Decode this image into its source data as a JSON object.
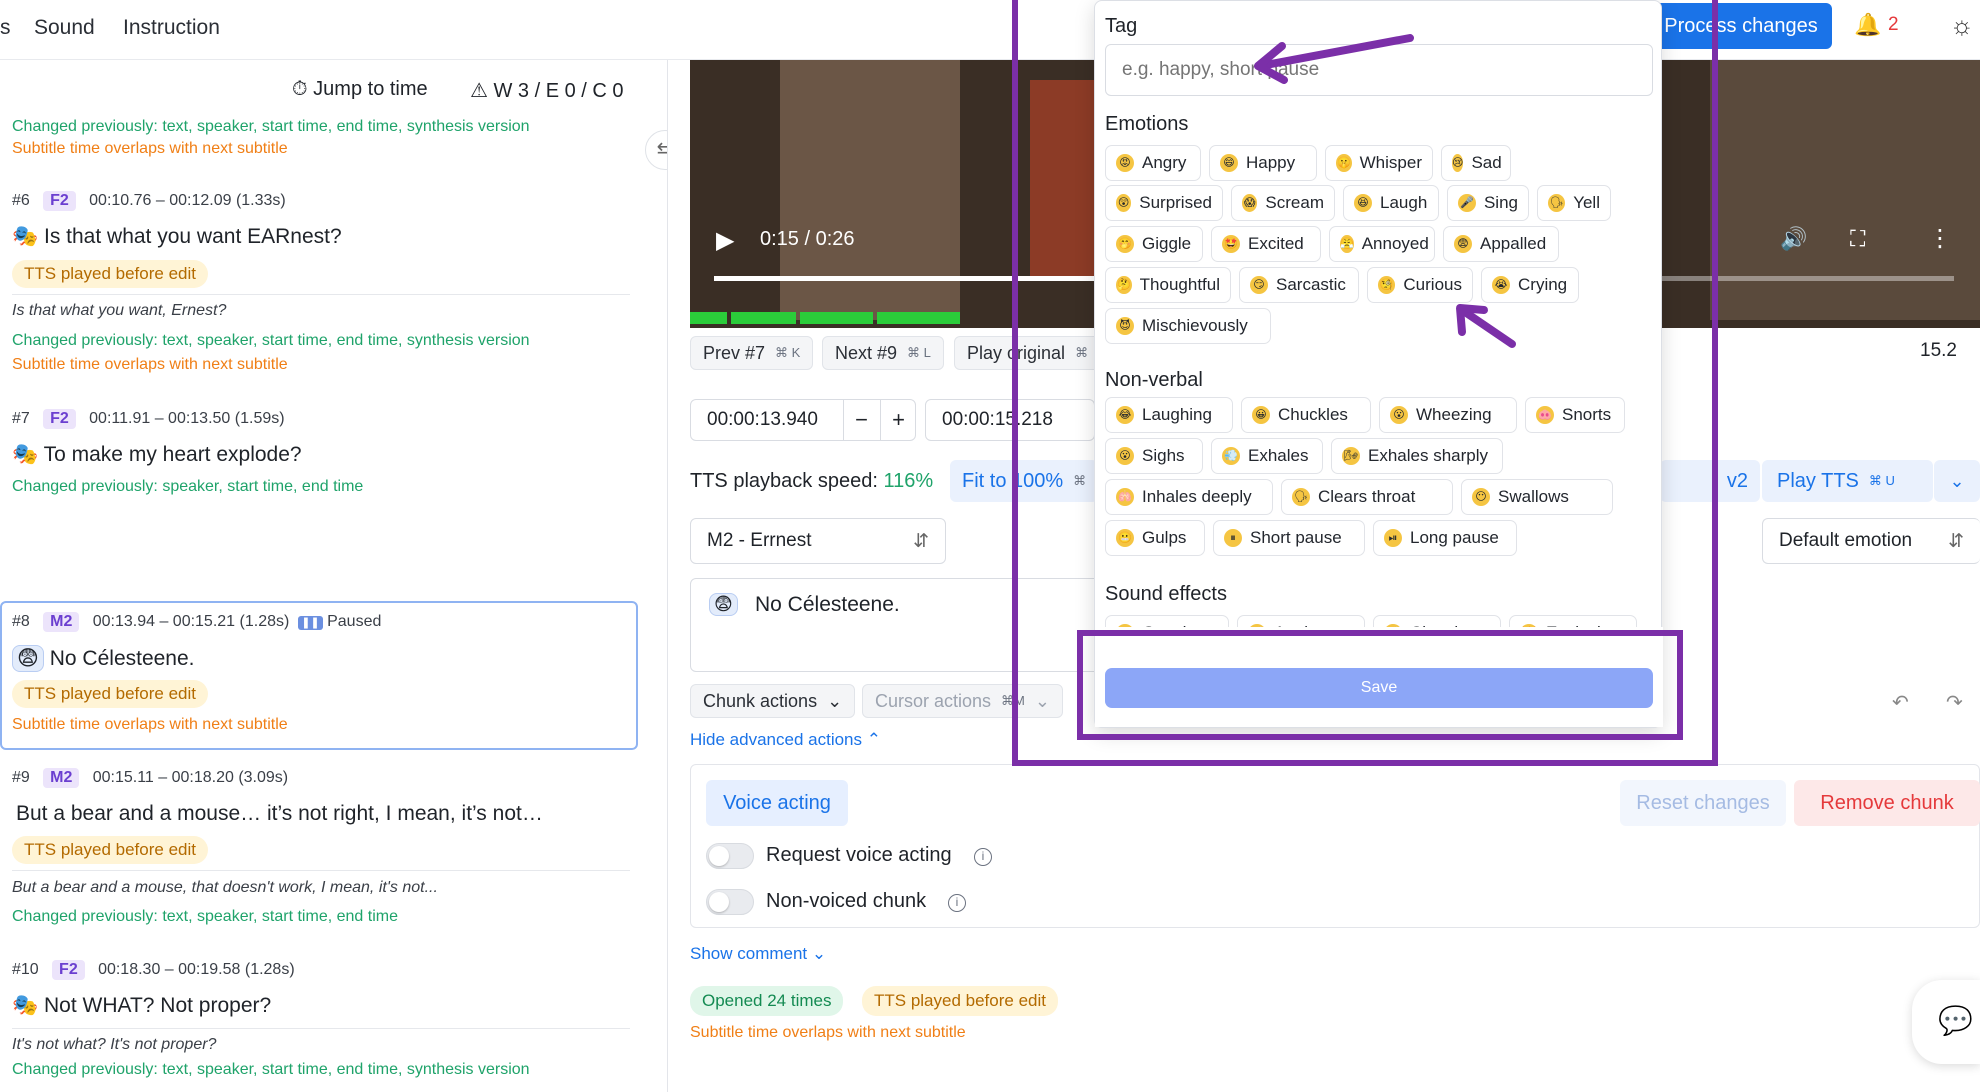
{
  "nav": {
    "item0": "s",
    "item1": "Sound",
    "item2": "Instruction"
  },
  "header": {
    "process_btn": "Process changes",
    "notif_count": "2"
  },
  "left": {
    "jump_to_time": "Jump to time",
    "warnings": "W 3 / E 0 / C 0",
    "top_changed": "Changed previously: text, speaker, start time, end time, synthesis version",
    "top_overlap": "Subtitle time overlaps with next subtitle",
    "items": [
      {
        "num": "#6",
        "speaker": "F2",
        "time": "00:10.76 – 00:12.09 (1.33s)",
        "text": "Is that what you want EARnest?",
        "tts": "TTS played before edit",
        "orig": "Is that what you want, Ernest?",
        "changed": "Changed previously: text, speaker, start time, end time, synthesis version",
        "overlap": "Subtitle time overlaps with next subtitle"
      },
      {
        "num": "#7",
        "speaker": "F2",
        "time": "00:11.91 – 00:13.50 (1.59s)",
        "text": "To make my heart explode?",
        "changed": "Changed previously: speaker, start time, end time"
      },
      {
        "num": "#8",
        "speaker": "M2",
        "time": "00:13.94 – 00:15.21 (1.28s)",
        "paused": "Paused",
        "text": "No Célesteene.",
        "tts": "TTS played before edit",
        "overlap": "Subtitle time overlaps with next subtitle"
      },
      {
        "num": "#9",
        "speaker": "M2",
        "time": "00:15.11 – 00:18.20 (3.09s)",
        "text": "But a bear and a mouse… it’s not right, I mean, it’s not…",
        "tts": "TTS played before edit",
        "orig": "But a bear and a mouse, that doesn't work, I mean, it's not...",
        "changed": "Changed previously: text, speaker, start time, end time"
      },
      {
        "num": "#10",
        "speaker": "F2",
        "time": "00:18.30 – 00:19.58 (1.28s)",
        "text": "Not WHAT? Not proper?",
        "orig": "It's not what? It's not proper?",
        "changed": "Changed previously: text, speaker, start time, end time, synthesis version"
      }
    ]
  },
  "video": {
    "time": "0:15 / 0:26",
    "progress": 0.58
  },
  "controls": {
    "prev": "Prev #7",
    "prev_kbd": "⌘ K",
    "next": "Next #9",
    "next_kbd": "⌘ L",
    "play_original": "Play original",
    "play_original_kbd": "⌘",
    "right_number": "15.2",
    "start_time": "00:00:13.940",
    "end_time": "00:00:15.218",
    "tts_speed_label": "TTS playback speed:",
    "tts_speed_value": "116%",
    "fit_to": "Fit to 100%",
    "fit_kbd": "⌘",
    "version": "v2",
    "play_tts": "Play TTS",
    "play_tts_kbd": "⌘ U",
    "speaker_select": "M2 - Errnest",
    "emotion_select": "Default emotion",
    "chunk_text": "No Célesteene.",
    "chunk_actions": "Chunk actions",
    "cursor_actions": "Cursor actions",
    "cursor_kbd": "⌘M",
    "hide_advanced": "Hide advanced actions",
    "voice_acting_tab": "Voice acting",
    "reset_changes": "Reset changes",
    "remove_chunk": "Remove chunk",
    "request_voice_acting": "Request voice acting",
    "non_voiced": "Non-voiced chunk",
    "show_comment": "Show comment",
    "opened": "Opened 24 times",
    "tts_before": "TTS played before edit",
    "overlap": "Subtitle time overlaps with next subtitle"
  },
  "popup": {
    "tag_label": "Tag",
    "tag_placeholder": "e.g. happy, short pause",
    "emotions_label": "Emotions",
    "emotions": [
      "Angry",
      "Happy",
      "Whisper",
      "Sad",
      "Surprised",
      "Scream",
      "Laugh",
      "Sing",
      "Yell",
      "Giggle",
      "Excited",
      "Annoyed",
      "Appalled",
      "Thoughtful",
      "Sarcastic",
      "Curious",
      "Crying",
      "Mischievously"
    ],
    "nonverbal_label": "Non-verbal",
    "nonverbal": [
      "Laughing",
      "Chuckles",
      "Wheezing",
      "Snorts",
      "Sighs",
      "Exhales",
      "Exhales sharply",
      "Inhales deeply",
      "Clears throat",
      "Swallows",
      "Gulps",
      "Short pause",
      "Long pause"
    ],
    "sfx_label": "Sound effects",
    "sfx": [
      "Gunshot",
      "Applause",
      "Clapping",
      "Explosion"
    ],
    "save": "Save"
  },
  "colors": {
    "accent": "#1a73e8",
    "purple_annotation": "#7b2fa8",
    "save": "#8ca6f7",
    "green": "#1fa36a",
    "orange": "#f07f16"
  }
}
